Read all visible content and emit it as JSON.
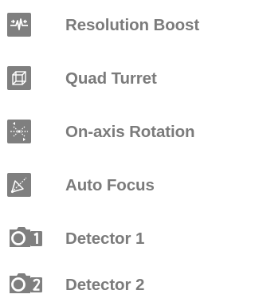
{
  "colors": {
    "icon_fill": "#7f7f7f",
    "icon_glyph": "#ffffff",
    "label_text": "#7b7b7b",
    "background": "#ffffff"
  },
  "features": [
    {
      "label": "Resolution Boost",
      "icon": "resolution-boost-icon"
    },
    {
      "label": "Quad Turret",
      "icon": "quad-turret-icon"
    },
    {
      "label": "On-axis Rotation",
      "icon": "on-axis-rotation-icon"
    },
    {
      "label": "Auto Focus",
      "icon": "auto-focus-icon"
    },
    {
      "label": "Detector 1",
      "icon": "detector-1-icon"
    },
    {
      "label": "Detector 2",
      "icon": "detector-2-icon"
    }
  ]
}
